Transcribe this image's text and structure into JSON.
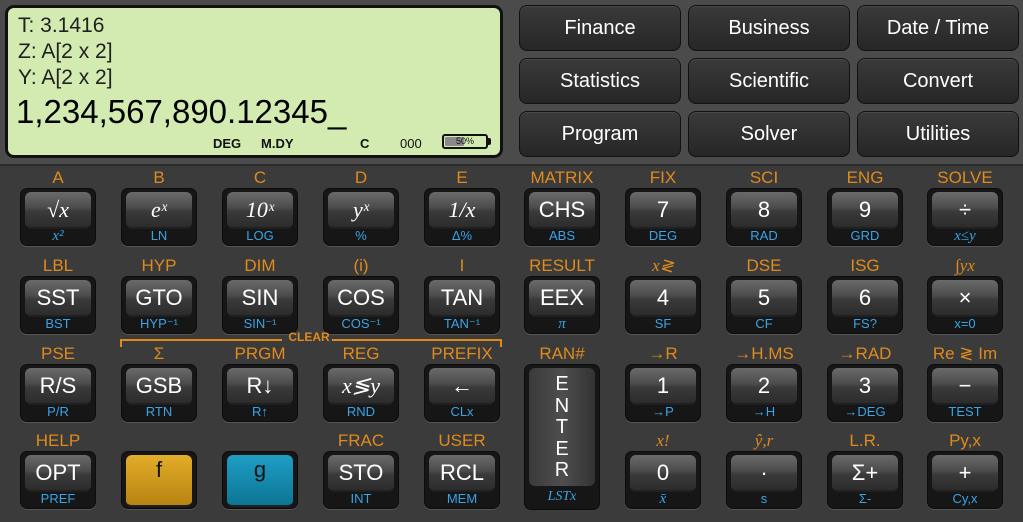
{
  "display": {
    "t": "T:  3.1416",
    "z": "Z: A[2 x 2]",
    "y": "Y: A[2 x 2]",
    "x": "1,234,567,890.12345_",
    "annunciators": {
      "angle": "DEG",
      "date": "M.DY",
      "mode": "C",
      "memory": "000"
    },
    "battery": {
      "text": "50%",
      "level": 0.5
    }
  },
  "menu": [
    "Finance",
    "Business",
    "Date / Time",
    "Statistics",
    "Scientific",
    "Convert",
    "Program",
    "Solver",
    "Utilities"
  ],
  "keys": {
    "r1": [
      {
        "f": "A",
        "main": "√x",
        "g": "x²",
        "serif": true,
        "gIt": true
      },
      {
        "f": "B",
        "main": "eˣ",
        "g": "LN",
        "serif": true
      },
      {
        "f": "C",
        "main": "10ˣ",
        "g": "LOG",
        "serif": true
      },
      {
        "f": "D",
        "main": "yˣ",
        "g": "%",
        "serif": true
      },
      {
        "f": "E",
        "main": "1/x",
        "g": "Δ%",
        "serif": true
      },
      {
        "f": "MATRIX",
        "main": "CHS",
        "g": "ABS"
      },
      {
        "f": "FIX",
        "main": "7",
        "g": "DEG"
      },
      {
        "f": "SCI",
        "main": "8",
        "g": "RAD"
      },
      {
        "f": "ENG",
        "main": "9",
        "g": "GRD"
      },
      {
        "f": "SOLVE",
        "main": "÷",
        "g": "x≤y",
        "gIt": true
      }
    ],
    "r2": [
      {
        "f": "LBL",
        "main": "SST",
        "g": "BST"
      },
      {
        "f": "HYP",
        "main": "GTO",
        "g": "HYP⁻¹"
      },
      {
        "f": "DIM",
        "main": "SIN",
        "g": "SIN⁻¹"
      },
      {
        "f": "(i)",
        "main": "COS",
        "g": "COS⁻¹"
      },
      {
        "f": "I",
        "main": "TAN",
        "g": "TAN⁻¹"
      },
      {
        "f": "RESULT",
        "main": "EEX",
        "g": "π",
        "gIt": true
      },
      {
        "f": "x≷",
        "main": "4",
        "g": "SF",
        "fIt": true
      },
      {
        "f": "DSE",
        "main": "5",
        "g": "CF"
      },
      {
        "f": "ISG",
        "main": "6",
        "g": "FS?"
      },
      {
        "f": "∫yx",
        "main": "×",
        "g": "x=0",
        "fIt": true
      }
    ],
    "r3": [
      {
        "f": "PSE",
        "main": "R/S",
        "g": "P/R"
      },
      {
        "f": "Σ",
        "main": "GSB",
        "g": "RTN"
      },
      {
        "f": "PRGM",
        "main": "R↓",
        "g": "R↑"
      },
      {
        "f": "REG",
        "main": "x≶y",
        "g": "RND",
        "serif": true
      },
      {
        "f": "PREFIX",
        "main": "←",
        "g": "CLx"
      },
      {
        "f": "RAN#",
        "main": "",
        "g": ""
      },
      {
        "f": "→R",
        "main": "1",
        "g": "→P"
      },
      {
        "f": "→H.MS",
        "main": "2",
        "g": "→H"
      },
      {
        "f": "→RAD",
        "main": "3",
        "g": "→DEG"
      },
      {
        "f": "Re ≷ Im",
        "main": "−",
        "g": "TEST"
      }
    ],
    "r4": [
      {
        "f": "HELP",
        "main": "OPT",
        "g": "PREF"
      },
      {
        "f": "",
        "main": "f",
        "g": ""
      },
      {
        "f": "",
        "main": "g",
        "g": ""
      },
      {
        "f": "FRAC",
        "main": "STO",
        "g": "INT"
      },
      {
        "f": "USER",
        "main": "RCL",
        "g": "MEM"
      },
      {
        "f": "",
        "main": "",
        "g": ""
      },
      {
        "f": "x!",
        "main": "0",
        "g": "x̄",
        "fIt": true,
        "gIt": true
      },
      {
        "f": "ŷ,r",
        "main": "·",
        "g": "s",
        "fIt": true
      },
      {
        "f": "L.R.",
        "main": "Σ+",
        "g": "Σ-"
      },
      {
        "f": "Py,x",
        "main": "+",
        "g": "Cy,x"
      }
    ],
    "enter": {
      "letters": [
        "E",
        "N",
        "T",
        "E",
        "R"
      ],
      "g": "LSTx"
    },
    "clear": "CLEAR"
  },
  "colors": {
    "f": "#e08a1c",
    "g": "#3aa4e6",
    "lcd": "#d3ebb1",
    "fkey": "#d9a21f",
    "gkey": "#1690b6"
  }
}
